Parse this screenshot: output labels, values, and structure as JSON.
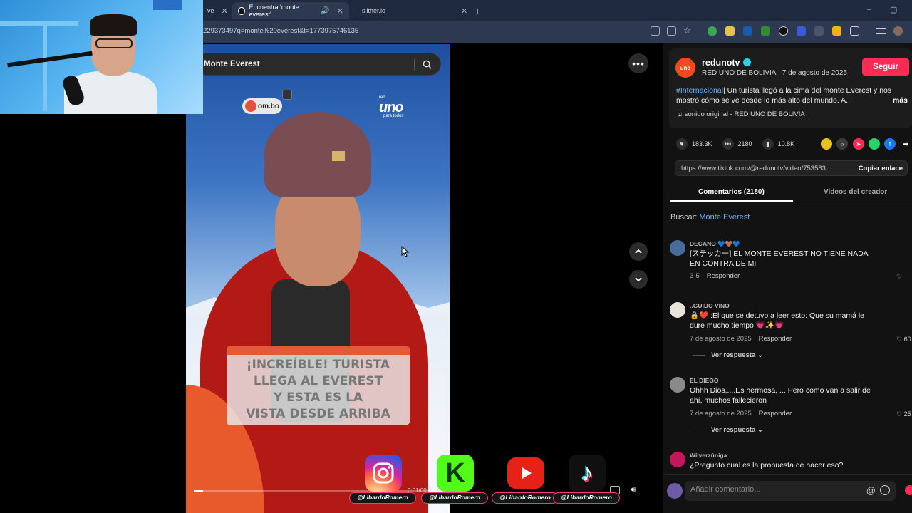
{
  "browser": {
    "tab_partial": "ve",
    "tabs": [
      {
        "title": "Encuentra 'monte everest'"
      },
      {
        "title": "slither.io"
      }
    ],
    "new_tab": "+",
    "url": "229373497q=monte%20everest&t=1773975746135",
    "window_controls": [
      "–",
      "▢"
    ]
  },
  "search": {
    "value": "Monte Everest"
  },
  "video": {
    "watermark_partial": "om.bo",
    "channel_logo": {
      "top": "red",
      "main": "uno",
      "sub": "para todos"
    },
    "caption": "¡INCREÍBLE! TURISTA\nLLEGA AL EVEREST\nY ESTA ES LA\nVISTA DESDE ARRIBA",
    "time": "0:01/00:2",
    "progress_fraction": 0.04
  },
  "creator": {
    "avatar_text": "uno",
    "username": "redunotv",
    "subline": "RED UNO DE BOLIVIA · 7 de agosto de 2025",
    "follow_label": "Seguir",
    "desc_tag": "#Internacional",
    "desc_text": "| Un turista llegó a la cima del monte Everest y nos mostró cómo se ve desde lo más alto del mundo. A...",
    "desc_more": "más",
    "sound": "♫  sonido original - RED UNO DE BOLIVIA"
  },
  "stats": {
    "likes": "183.3K",
    "comments": "2180",
    "saves": "10.8K"
  },
  "share": {
    "link": "https://www.tiktok.com/@redunotv/video/753583...",
    "copy_label": "Copiar enlace"
  },
  "tabs": {
    "comments": "Comentarios (2180)",
    "creator_videos": "Videos del creador"
  },
  "buscar": {
    "label": "Buscar: ",
    "query": "Monte Everest"
  },
  "comments": [
    {
      "user": "DECANO 💙🤎💙",
      "text": "[ステッカー] EL MONTE EVEREST NO TIENE NADA EN CONTRA DE MI",
      "date": "3-5",
      "reply": "Responder",
      "likes": "",
      "view_replies": ""
    },
    {
      "user": "..GUIDO VINO",
      "text": "🔒❤️ :El que se detuvo a leer esto: Que su mamá le dure mucho tiempo 💗✨💗",
      "date": "7 de agosto de 2025",
      "reply": "Responder",
      "likes": "60",
      "view_replies": "Ver respuesta ⌄"
    },
    {
      "user": "EL DIEGO",
      "text": "Ohhh Dios,....Es hermosa, ... Pero como van a salir de ahí, muchos fallecieron",
      "date": "7 de agosto de 2025",
      "reply": "Responder",
      "likes": "25",
      "view_replies": "Ver respuesta ⌄"
    },
    {
      "user": "Wilverzúniga",
      "text": "¿Pregunto cual es la propuesta de hacer eso?",
      "date": "",
      "reply": "",
      "likes": "",
      "view_replies": ""
    }
  ],
  "comment_input": {
    "placeholder": "Añadir comentario...",
    "at": "@"
  },
  "social_overlay": [
    {
      "icon": "instagram-icon",
      "handle": "@LibardoRomero",
      "color": "#d62976"
    },
    {
      "icon": "kick-icon",
      "handle": "@LibardoRomero",
      "color": "#53fc18"
    },
    {
      "icon": "youtube-icon",
      "handle": "@LibardoRomero",
      "color": "#e62117"
    },
    {
      "icon": "tiktok-icon",
      "handle": "@LibardoRomero",
      "color": "#101010"
    }
  ],
  "colors": {
    "tiktok_red": "#fe2c55",
    "link_blue": "#6ab0ff",
    "browser_bg": "#2c3950",
    "orange": "#e85a2c"
  }
}
